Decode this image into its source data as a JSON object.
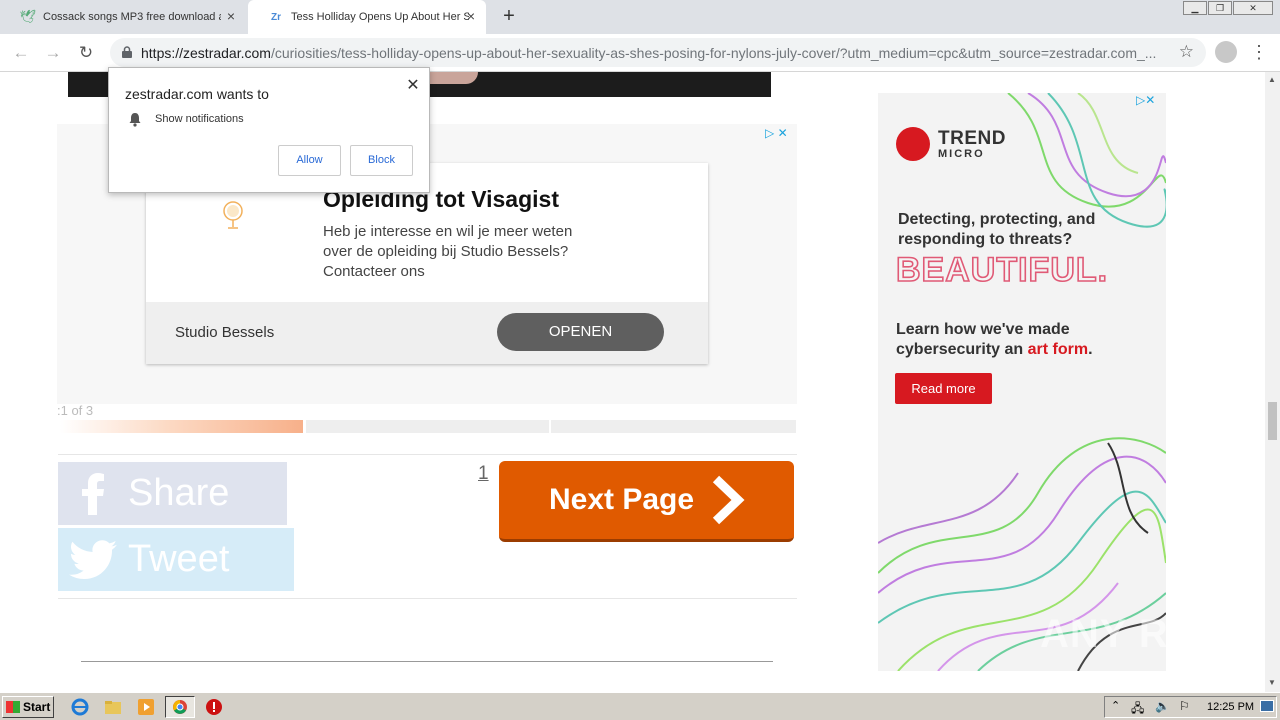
{
  "browser": {
    "tabs": [
      {
        "title": "Cossack songs MP3 free download a",
        "active": false
      },
      {
        "title": "Tess Holliday Opens Up About Her S",
        "active": true
      }
    ],
    "url_host": "https://zestradar.com",
    "url_path": "/curiosities/tess-holliday-opens-up-about-her-sexuality-as-shes-posing-for-nylons-july-cover/?utm_medium=cpc&utm_source=zestradar.com_..."
  },
  "notification": {
    "title": "zestradar.com wants to",
    "permission": "Show notifications",
    "allow_label": "Allow",
    "block_label": "Block"
  },
  "ad": {
    "title": "Opleiding tot Visagist",
    "body": "Heb je interesse en wil je meer weten over de opleiding bij Studio Bessels? Contacteer ons",
    "brand": "Studio Bessels",
    "cta": "OPENEN"
  },
  "article": {
    "slide_count": ":1 of 3",
    "progress_fraction": 1,
    "progress_total": 3,
    "share_label": "Share",
    "tweet_label": "Tweet",
    "page_number": "1",
    "next_label": "Next Page"
  },
  "side_ad": {
    "brand": "TREND",
    "brand_sub": "MICRO",
    "headline": "Detecting, protecting, and responding to threats?",
    "big_word": "BEAUTIFUL.",
    "subline_start": "Learn how we've made cybersecurity an ",
    "subline_highlight": "art form",
    "subline_end": ".",
    "cta": "Read more"
  },
  "taskbar": {
    "start_label": "Start",
    "clock": "12:25 PM"
  },
  "watermark": "ANY RUN",
  "colors": {
    "next_button": "#e05a00",
    "trend_red": "#d71920",
    "ad_choice": "#1aa3dd"
  }
}
